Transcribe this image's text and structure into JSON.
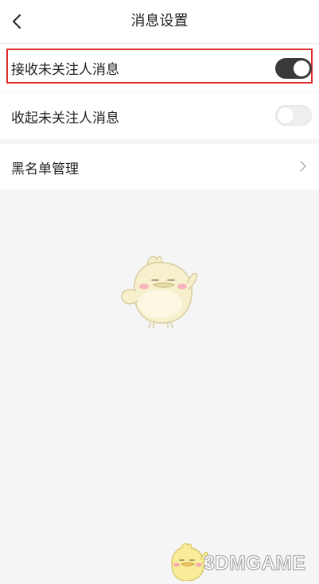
{
  "header": {
    "title": "消息设置",
    "back_icon": "chevron-left-icon"
  },
  "settings": {
    "receive_unfollowed": {
      "label": "接收未关注人消息",
      "enabled": true,
      "highlight_color": "#e02b2b"
    },
    "collapse_unfollowed": {
      "label": "收起未关注人消息",
      "enabled": false
    },
    "blacklist": {
      "label": "黑名单管理",
      "icon": "chevron-right-icon"
    }
  },
  "empty_state": {
    "illustration": "mascot-bird-illustration"
  },
  "watermark": {
    "text": "3DMGAME"
  },
  "colors": {
    "toggle_on": "#3a3a3a",
    "toggle_off": "#eeeeee",
    "background": "#f5f5f5"
  }
}
